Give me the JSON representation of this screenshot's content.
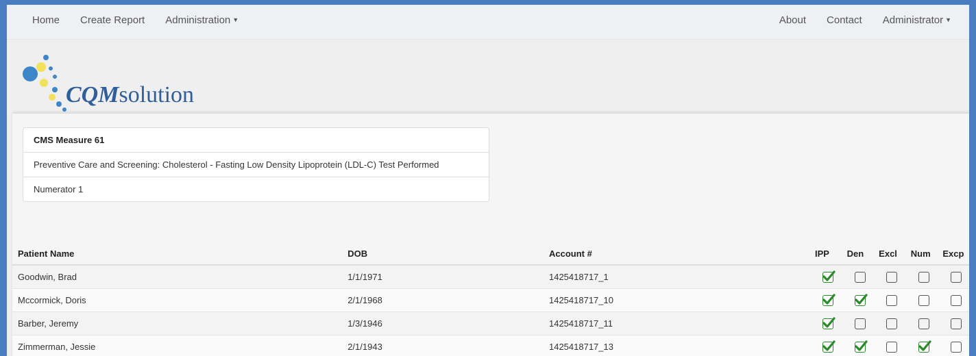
{
  "navbar": {
    "left": [
      {
        "label": "Home"
      },
      {
        "label": "Create Report"
      },
      {
        "label": "Administration",
        "dropdown": true
      }
    ],
    "right": [
      {
        "label": "About"
      },
      {
        "label": "Contact"
      },
      {
        "label": "Administrator",
        "dropdown": true
      }
    ]
  },
  "brand": {
    "bold": "CQM",
    "rest": "solution"
  },
  "measure": {
    "title": "CMS Measure 61",
    "description": "Preventive Care and Screening: Cholesterol - Fasting Low Density Lipoprotein (LDL-C) Test Performed",
    "numerator": "Numerator 1"
  },
  "table": {
    "headers": {
      "name": "Patient Name",
      "dob": "DOB",
      "account": "Account #",
      "ipp": "IPP",
      "den": "Den",
      "excl": "Excl",
      "num": "Num",
      "excp": "Excp"
    },
    "rows": [
      {
        "name": "Goodwin, Brad",
        "dob": "1/1/1971",
        "account": "1425418717_1",
        "ipp": true,
        "den": false,
        "excl": false,
        "num": false,
        "excp": false
      },
      {
        "name": "Mccormick, Doris",
        "dob": "2/1/1968",
        "account": "1425418717_10",
        "ipp": true,
        "den": true,
        "excl": false,
        "num": false,
        "excp": false
      },
      {
        "name": "Barber, Jeremy",
        "dob": "1/3/1946",
        "account": "1425418717_11",
        "ipp": true,
        "den": false,
        "excl": false,
        "num": false,
        "excp": false
      },
      {
        "name": "Zimmerman, Jessie",
        "dob": "2/1/1943",
        "account": "1425418717_13",
        "ipp": true,
        "den": true,
        "excl": false,
        "num": true,
        "excp": false
      }
    ]
  },
  "colors": {
    "check": "#2a8a2a",
    "brand": "#2f5e9b",
    "frame": "#4a7cc0"
  }
}
